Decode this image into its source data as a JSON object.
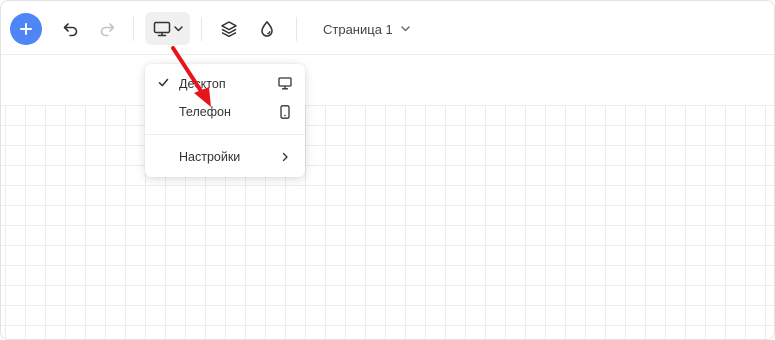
{
  "toolbar": {
    "add_icon": "plus-icon",
    "undo_icon": "undo-icon",
    "redo_icon": "redo-icon",
    "device_icon": "monitor-icon",
    "layers_icon": "layers-icon",
    "fill_icon": "drop-icon",
    "page_select": {
      "selected": "Страница 1"
    }
  },
  "device_menu": {
    "items": [
      {
        "label": "Десктоп",
        "checked": true,
        "icon": "monitor-icon"
      },
      {
        "label": "Телефон",
        "checked": false,
        "icon": "phone-icon"
      }
    ],
    "settings": {
      "label": "Настройки",
      "icon": "chevron-right-icon"
    }
  },
  "colors": {
    "accent": "#4f86f5",
    "annotation_arrow": "#e8141c",
    "grid_line": "#ececec"
  }
}
